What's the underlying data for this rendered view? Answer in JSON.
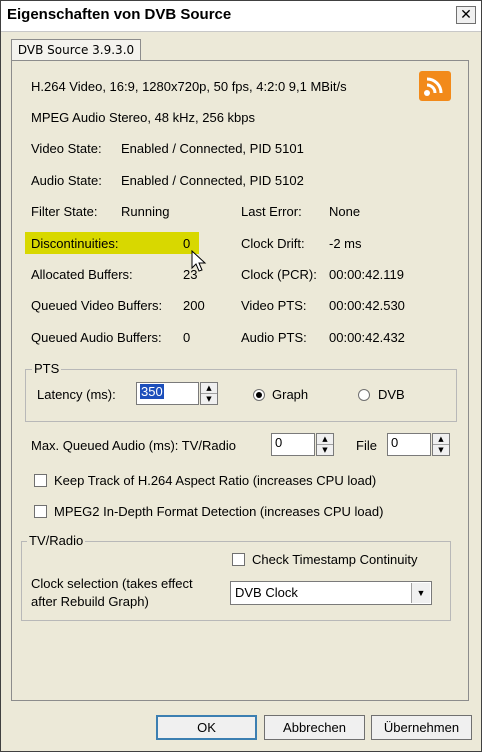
{
  "window": {
    "title": "Eigenschaften von DVB Source",
    "close_glyph": "✕"
  },
  "tab": {
    "label": "DVB Source 3.9.3.0"
  },
  "info": {
    "video_line": "H.264 Video, 16:9, 1280x720p, 50 fps, 4:2:0   9,1 MBit/s",
    "audio_line": "MPEG Audio Stereo, 48 kHz, 256 kbps",
    "video_state_label": "Video State:",
    "video_state_value": "Enabled / Connected, PID 5101",
    "audio_state_label": "Audio State:",
    "audio_state_value": "Enabled / Connected, PID 5102",
    "filter_state_label": "Filter State:",
    "filter_state_value": "Running",
    "last_error_label": "Last Error:",
    "last_error_value": "None",
    "discontinuities_label": "Discontinuities:",
    "discontinuities_value": "0",
    "clock_drift_label": "Clock Drift:",
    "clock_drift_value": "-2 ms",
    "allocated_buffers_label": "Allocated Buffers:",
    "allocated_buffers_value": "23",
    "clock_pcr_label": "Clock (PCR):",
    "clock_pcr_value": "00:00:42.119",
    "queued_video_label": "Queued Video Buffers:",
    "queued_video_value": "200",
    "video_pts_label": "Video PTS:",
    "video_pts_value": "00:00:42.530",
    "queued_audio_label": "Queued Audio Buffers:",
    "queued_audio_value": "0",
    "audio_pts_label": "Audio PTS:",
    "audio_pts_value": "00:00:42.432",
    "highlight_color": "#d8d800",
    "icon": "rss-feed-icon"
  },
  "pts": {
    "group_title": "PTS",
    "latency_label": "Latency (ms):",
    "latency_value": "350",
    "radio_graph": "Graph",
    "radio_dvb": "DVB",
    "selected": "Graph"
  },
  "queued_audio": {
    "label": "Max. Queued Audio (ms): TV/Radio",
    "tv_value": "0",
    "file_label": "File",
    "file_value": "0"
  },
  "options": {
    "aspect_ratio": "Keep Track of H.264 Aspect Ratio (increases CPU load)",
    "mpeg2_detect": "MPEG2 In-Depth Format Detection (increases CPU load)"
  },
  "tvradio": {
    "group_title": "TV/Radio",
    "timestamp_check": "Check Timestamp Continuity",
    "clock_label_line1": "Clock selection (takes effect",
    "clock_label_line2": "after Rebuild Graph)",
    "clock_value": "DVB Clock"
  },
  "buttons": {
    "ok": "OK",
    "cancel": "Abbrechen",
    "apply": "Übernehmen"
  },
  "colors": {
    "accent_orange": "#f28a1a",
    "selection_blue": "#1c4fbb"
  }
}
